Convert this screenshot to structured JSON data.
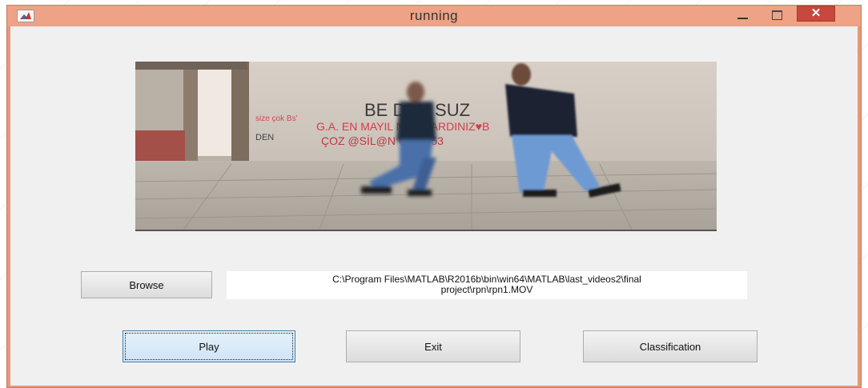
{
  "window": {
    "title": "running",
    "close_glyph": "✕"
  },
  "video": {
    "alt": "frame of two people running in front of a graffiti wall",
    "graffiti": {
      "line1": "BE  DEN      SUZ",
      "line2": "G.A.  EN    MAYIL NASIL  ARDINIZ♥B",
      "line3": "ÇOZ  @SİL@N        G.Ü.  053",
      "left1": "size çok Bs'",
      "left2": "DEN"
    }
  },
  "controls": {
    "browse_label": "Browse",
    "path_line1": "C:\\Program Files\\MATLAB\\R2016b\\bin\\win64\\MATLAB\\last_videos2\\final",
    "path_line2": "project\\rpn\\rpn1.MOV",
    "play_label": "Play",
    "exit_label": "Exit",
    "classification_label": "Classification"
  },
  "icons": {
    "app": "matlab-logo-icon",
    "minimize": "minimize-icon",
    "maximize": "maximize-icon",
    "close": "close-icon"
  },
  "colors": {
    "titlebar": "#eea286",
    "close_button": "#c7483e",
    "client_bg": "#f0f0f0",
    "focused_button": "#cfe4f6"
  }
}
